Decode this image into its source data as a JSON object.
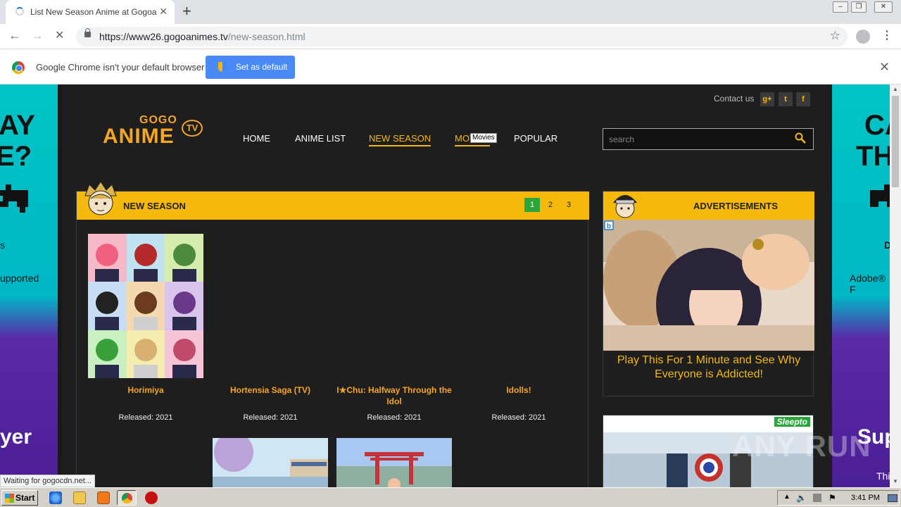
{
  "browser": {
    "tab_title": "List New Season Anime at Gogoanime",
    "url_host": "https://www26.gogoanimes.tv",
    "url_path": "/new-season.html",
    "infobar_message": "Google Chrome isn't your default browser",
    "set_default_label": "Set as default",
    "status_text": "Waiting for gogocdn.net..."
  },
  "site": {
    "contact_label": "Contact us",
    "social": [
      "g+",
      "t",
      "f"
    ],
    "logo": {
      "gogo": "GOGO",
      "anime": "ANIME",
      "tv": "TV"
    },
    "nav": [
      "HOME",
      "ANIME LIST",
      "NEW SEASON",
      "MOVIES",
      "POPULAR"
    ],
    "tooltip": "Movies",
    "search_placeholder": "search"
  },
  "new_season": {
    "title": "NEW SEASON",
    "pages": [
      "1",
      "2",
      "3"
    ],
    "cards": [
      {
        "name": "Horimiya",
        "released": "Released: 2021"
      },
      {
        "name": "Hortensia Saga (TV)",
        "released": "Released: 2021"
      },
      {
        "name": "I★Chu: Halfway Through the Idol",
        "released": "Released: 2021"
      },
      {
        "name": "Idolls!",
        "released": "Released: 2021"
      }
    ]
  },
  "ads": {
    "title": "ADVERTISEMENTS",
    "caption": "Play This For 1 Minute and See Why Everyone is Addicted!",
    "sponsor": "Sleepto"
  },
  "side_ads": {
    "left": {
      "line1": "AY",
      "line2": "E?",
      "small1": "s",
      "small2": "upported",
      "bottom": "yer"
    },
    "right": {
      "line1": "CA",
      "line2": "TH",
      "small1": "D",
      "small2": "Adobe® F",
      "bottom": "Sup",
      "tiny": "Thi"
    }
  },
  "watermark": "ANY RUN",
  "taskbar": {
    "start_label": "Start",
    "clock": "3:41 PM"
  }
}
